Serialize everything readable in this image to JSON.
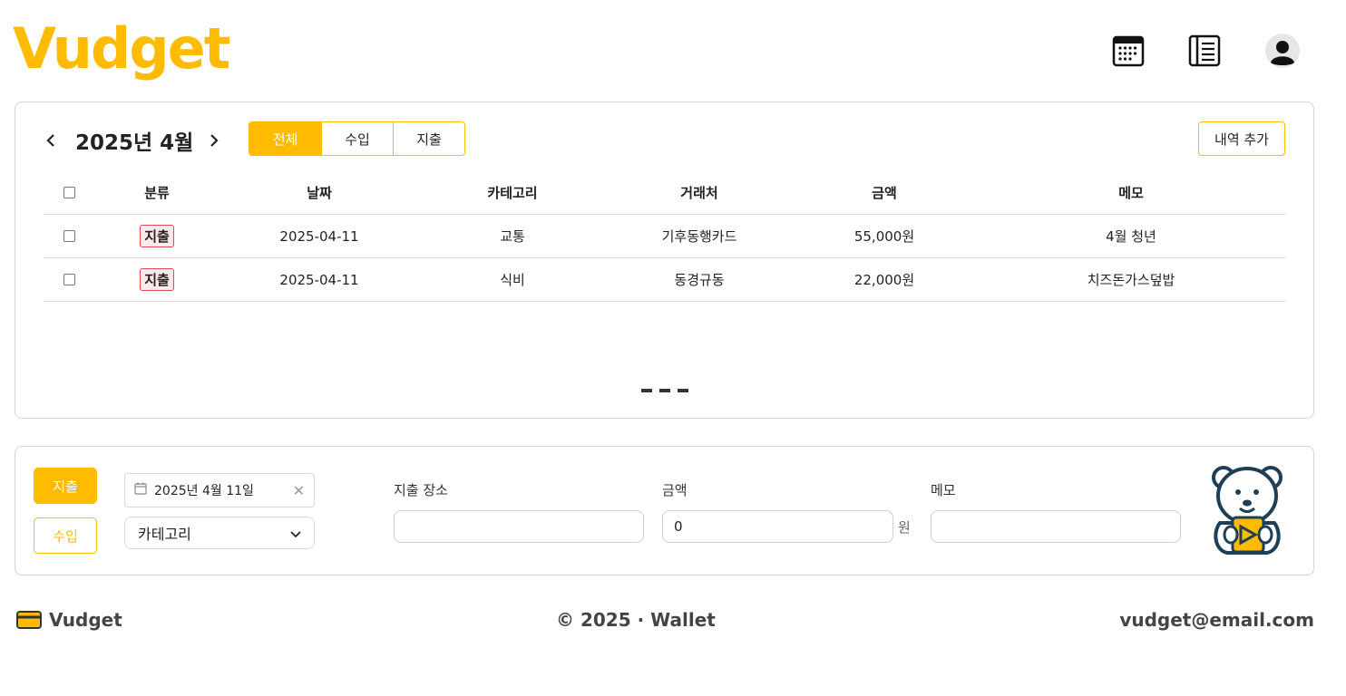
{
  "app": {
    "logo": "Vudget"
  },
  "header": {
    "icons": [
      "calendar-icon",
      "list-icon",
      "user-icon"
    ]
  },
  "ledger": {
    "month_title": "2025년 4월",
    "filter_tabs": [
      {
        "label": "전체",
        "active": true
      },
      {
        "label": "수입",
        "active": false
      },
      {
        "label": "지출",
        "active": false
      }
    ],
    "add_button": "내역 추가",
    "columns": [
      "분류",
      "날짜",
      "카테고리",
      "거래처",
      "금액",
      "메모"
    ],
    "rows": [
      {
        "type": "지출",
        "date": "2025-04-11",
        "category": "교통",
        "vendor": "기후동행카드",
        "amount": "55,000원",
        "memo": "4월 청년"
      },
      {
        "type": "지출",
        "date": "2025-04-11",
        "category": "식비",
        "vendor": "동경규동",
        "amount": "22,000원",
        "memo": "치즈돈가스덮밥"
      }
    ]
  },
  "entry": {
    "expense_button": "지출",
    "income_button": "수입",
    "date_value": "2025년 4월 11일",
    "category_placeholder": "카테고리",
    "place_label": "지출 장소",
    "place_value": "",
    "amount_label": "금액",
    "amount_value": "0",
    "amount_unit": "원",
    "memo_label": "메모",
    "memo_value": ""
  },
  "footer": {
    "brand": "Vudget",
    "copyright": "© 2025 · Wallet",
    "email": "vudget@email.com"
  },
  "colors": {
    "accent": "#FFBB00",
    "badge_border": "#e04b4b",
    "badge_bg": "#fde9e9"
  }
}
